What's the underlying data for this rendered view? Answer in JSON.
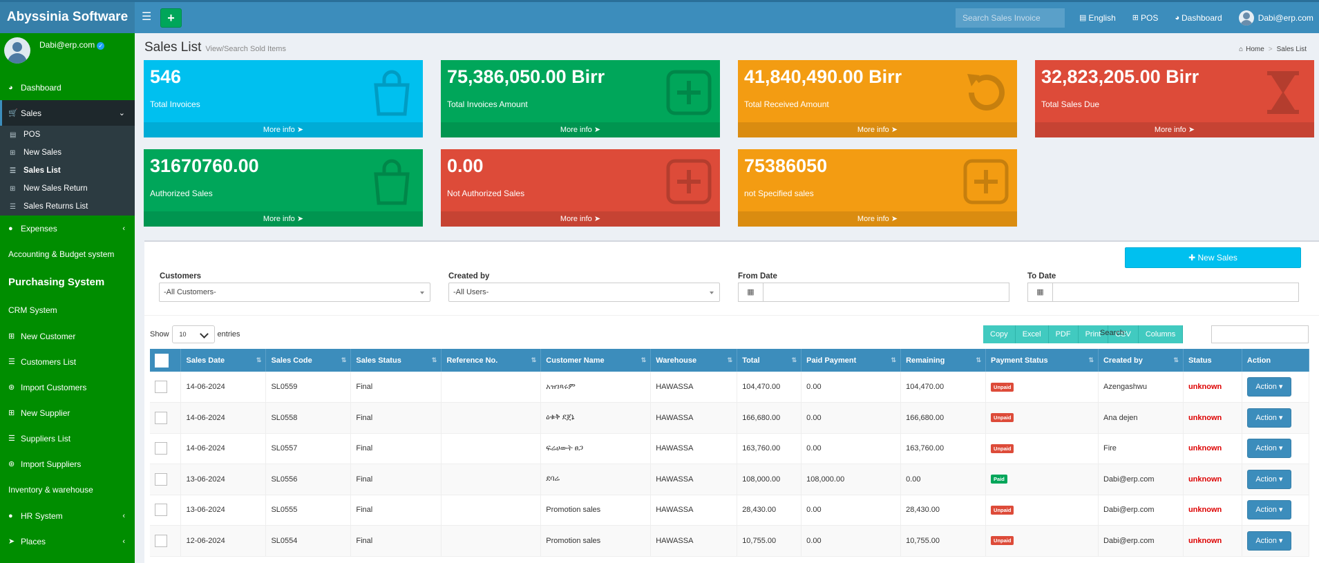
{
  "app": {
    "title": "Abyssinia Software"
  },
  "topbar": {
    "search_placeholder": "Search Sales Invoice",
    "language": "English",
    "pos": "POS",
    "dashboard": "Dashboard",
    "user": "Dabi@erp.com"
  },
  "sidebar": {
    "user": "Dabi@erp.com",
    "dashboard": "Dashboard",
    "sales": "Sales",
    "sales_sub": [
      "POS",
      "New Sales",
      "Sales List",
      "New Sales Return",
      "Sales Returns List"
    ],
    "expenses": "Expenses",
    "accounting": "Accounting & Budget system",
    "purchasing": "Purchasing System",
    "crm": "CRM System",
    "crm_items": [
      "New Customer",
      "Customers List",
      "Import Customers",
      "New Supplier",
      "Suppliers List",
      "Import Suppliers"
    ],
    "inventory": "Inventory & warehouse",
    "hr": "HR System",
    "places": "Places"
  },
  "page": {
    "title": "Sales List",
    "subtitle": "View/Search Sold Items"
  },
  "breadcrumb": {
    "home": "Home",
    "current": "Sales List"
  },
  "boxes": [
    {
      "value": "546",
      "label": "Total Invoices",
      "more": "More info",
      "color": "#00c0ef",
      "icon": "shopping-bag-icon"
    },
    {
      "value": "75,386,050.00 Birr",
      "label": "Total Invoices Amount",
      "more": "More info",
      "color": "#00a65a",
      "icon": "plus-square-icon"
    },
    {
      "value": "41,840,490.00 Birr",
      "label": "Total Received Amount",
      "more": "More info",
      "color": "#f39c12",
      "icon": "undo-icon"
    },
    {
      "value": "32,823,205.00 Birr",
      "label": "Total Sales Due",
      "more": "More info",
      "color": "#dd4b39",
      "icon": "hourglass-icon"
    },
    {
      "value": "31670760.00",
      "label": "Authorized Sales",
      "more": "More info",
      "color": "#00a65a",
      "icon": "shopping-bag-icon"
    },
    {
      "value": "0.00",
      "label": "Not Authorized Sales",
      "more": "More info",
      "color": "#dd4b39",
      "icon": "plus-square-icon"
    },
    {
      "value": "75386050",
      "label": "not Specified sales",
      "more": "More info",
      "color": "#f39c12",
      "icon": "plus-square-icon"
    }
  ],
  "filters": {
    "new_sales": "New Sales",
    "customers_label": "Customers",
    "customers_value": "-All Customers-",
    "created_by_label": "Created by",
    "created_by_value": "-All Users-",
    "from_date_label": "From Date",
    "to_date_label": "To Date"
  },
  "table_controls": {
    "show": "Show",
    "length": "10",
    "entries": "entries",
    "buttons": [
      "Copy",
      "Excel",
      "PDF",
      "Print",
      "CSV",
      "Columns"
    ],
    "search_label": "Search:"
  },
  "table": {
    "columns": [
      "Sales Date",
      "Sales Code",
      "Sales Status",
      "Reference No.",
      "Customer Name",
      "Warehouse",
      "Total",
      "Paid Payment",
      "Remaining",
      "Payment Status",
      "Created by",
      "Status",
      "Action"
    ],
    "rows": [
      {
        "date": "14-06-2024",
        "code": "SL0559",
        "status": "Final",
        "ref": "",
        "customer": "አዝገጻሩም",
        "warehouse": "HAWASSA",
        "total": "104,470.00",
        "paid": "0.00",
        "remaining": "104,470.00",
        "payment_status": "Unpaid",
        "created_by": "Azengashwu",
        "row_status": "unknown",
        "action": "Action"
      },
      {
        "date": "14-06-2024",
        "code": "SL0558",
        "status": "Final",
        "ref": "",
        "customer": "ዕቁቅ ደጀኔ",
        "warehouse": "HAWASSA",
        "total": "166,680.00",
        "paid": "0.00",
        "remaining": "166,680.00",
        "payment_status": "Unpaid",
        "created_by": "Ana dejen",
        "row_status": "unknown",
        "action": "Action"
      },
      {
        "date": "14-06-2024",
        "code": "SL0557",
        "status": "Final",
        "ref": "",
        "customer": "ፍሬሀውት ፀጋ",
        "warehouse": "HAWASSA",
        "total": "163,760.00",
        "paid": "0.00",
        "remaining": "163,760.00",
        "payment_status": "Unpaid",
        "created_by": "Fire",
        "row_status": "unknown",
        "action": "Action"
      },
      {
        "date": "13-06-2024",
        "code": "SL0556",
        "status": "Final",
        "ref": "",
        "customer": "ደባሬ",
        "warehouse": "HAWASSA",
        "total": "108,000.00",
        "paid": "108,000.00",
        "remaining": "0.00",
        "payment_status": "Paid",
        "created_by": "Dabi@erp.com",
        "row_status": "unknown",
        "action": "Action"
      },
      {
        "date": "13-06-2024",
        "code": "SL0555",
        "status": "Final",
        "ref": "",
        "customer": "Promotion sales",
        "warehouse": "HAWASSA",
        "total": "28,430.00",
        "paid": "0.00",
        "remaining": "28,430.00",
        "payment_status": "Unpaid",
        "created_by": "Dabi@erp.com",
        "row_status": "unknown",
        "action": "Action"
      },
      {
        "date": "12-06-2024",
        "code": "SL0554",
        "status": "Final",
        "ref": "",
        "customer": "Promotion sales",
        "warehouse": "HAWASSA",
        "total": "10,755.00",
        "paid": "0.00",
        "remaining": "10,755.00",
        "payment_status": "Unpaid",
        "created_by": "Dabi@erp.com",
        "row_status": "unknown",
        "action": "Action"
      }
    ]
  }
}
